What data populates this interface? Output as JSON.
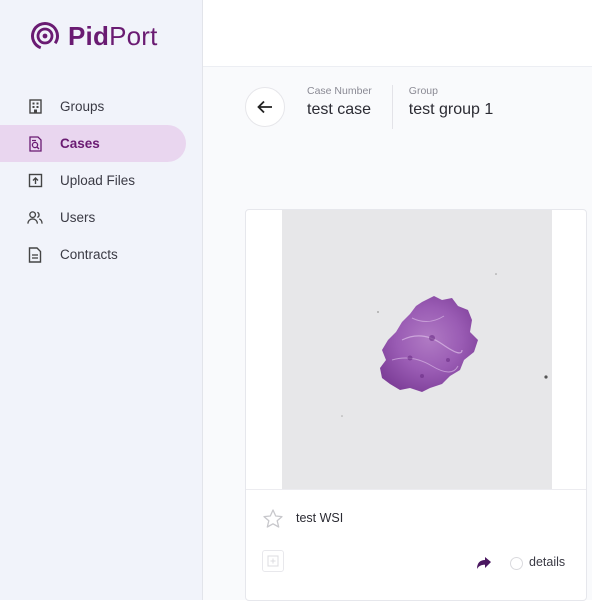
{
  "brand": {
    "name_bold": "Pid",
    "name_light": "Port",
    "color": "#6a1b72"
  },
  "sidebar": {
    "items": [
      {
        "label": "Groups",
        "icon": "building-icon",
        "active": false
      },
      {
        "label": "Cases",
        "icon": "case-search-icon",
        "active": true
      },
      {
        "label": "Upload Files",
        "icon": "upload-icon",
        "active": false
      },
      {
        "label": "Users",
        "icon": "users-icon",
        "active": false
      },
      {
        "label": "Contracts",
        "icon": "document-icon",
        "active": false
      }
    ]
  },
  "case": {
    "number_label": "Case Number",
    "number_value": "test case",
    "group_label": "Group",
    "group_value": "test group 1"
  },
  "card": {
    "name": "test WSI",
    "details_label": "details",
    "image": "whole-slide-image-thumbnail"
  }
}
